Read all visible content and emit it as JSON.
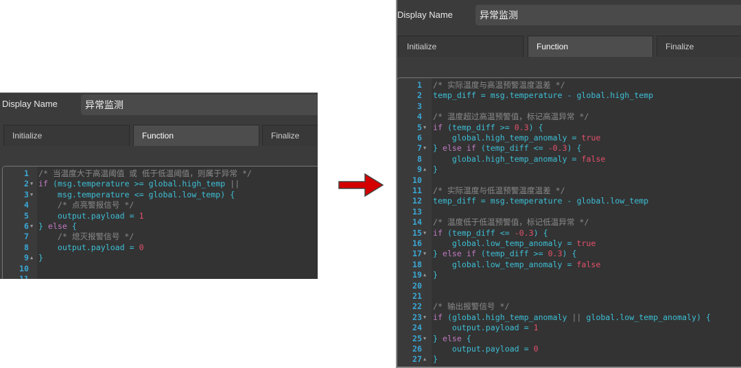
{
  "colors": {
    "arrow": "#d40000",
    "keyword": "#c07ac0",
    "identifier": "#3dbfd6",
    "literal": "#e4506c",
    "comment": "#8a8a8a",
    "line_number": "#3aa8d6"
  },
  "left": {
    "display_name_label": "Display Name",
    "display_name_value": "异常监测",
    "tabs": [
      {
        "label": "Initialize"
      },
      {
        "label": "Function",
        "active": true
      },
      {
        "label": "Finalize"
      }
    ],
    "code": [
      {
        "n": "1",
        "t": [
          [
            "c",
            "/* 当温度大于高温阈值 或 低于低温阈值，则属于异常 */"
          ]
        ]
      },
      {
        "n": "2",
        "f": "down",
        "t": [
          [
            "k",
            "if"
          ],
          [
            "p",
            " ("
          ],
          [
            "i",
            "msg.temperature"
          ],
          [
            "o",
            " >= "
          ],
          [
            "i",
            "global.high_temp"
          ],
          [
            "c",
            " ||"
          ]
        ]
      },
      {
        "n": "3",
        "f": "down",
        "t": [
          [
            "i",
            "    msg.temperature"
          ],
          [
            "o",
            " <= "
          ],
          [
            "i",
            "global.low_temp"
          ],
          [
            "p",
            ") {"
          ]
        ]
      },
      {
        "n": "4",
        "t": [
          [
            "c",
            "    /* 点亮警报信号 */"
          ]
        ]
      },
      {
        "n": "5",
        "t": [
          [
            "i",
            "    output.payload"
          ],
          [
            "o",
            " = "
          ],
          [
            "n",
            "1"
          ]
        ]
      },
      {
        "n": "6",
        "f": "down",
        "t": [
          [
            "p",
            "} "
          ],
          [
            "k",
            "else"
          ],
          [
            "p",
            " {"
          ]
        ]
      },
      {
        "n": "7",
        "t": [
          [
            "c",
            "    /* 熄灭报警信号 */"
          ]
        ]
      },
      {
        "n": "8",
        "t": [
          [
            "i",
            "    output.payload"
          ],
          [
            "o",
            " = "
          ],
          [
            "n",
            "0"
          ]
        ]
      },
      {
        "n": "9",
        "f": "up",
        "t": [
          [
            "p",
            "}"
          ]
        ]
      },
      {
        "n": "10",
        "t": []
      },
      {
        "n": "11",
        "t": []
      }
    ]
  },
  "right": {
    "display_name_label": "Display Name",
    "display_name_value": "异常监测",
    "tabs": [
      {
        "label": "Initialize"
      },
      {
        "label": "Function",
        "active": true
      },
      {
        "label": "Finalize"
      }
    ],
    "code": [
      {
        "n": "1",
        "t": [
          [
            "c",
            "/* 实际温度与高温预警温度温差 */"
          ]
        ]
      },
      {
        "n": "2",
        "t": [
          [
            "i",
            "temp_diff"
          ],
          [
            "o",
            " = "
          ],
          [
            "i",
            "msg.temperature"
          ],
          [
            "o",
            " - "
          ],
          [
            "i",
            "global.high_temp"
          ]
        ]
      },
      {
        "n": "3",
        "t": []
      },
      {
        "n": "4",
        "t": [
          [
            "c",
            "/* 温度超过高温预警值，标记高温异常 */"
          ]
        ]
      },
      {
        "n": "5",
        "f": "down",
        "t": [
          [
            "k",
            "if"
          ],
          [
            "p",
            " ("
          ],
          [
            "i",
            "temp_diff"
          ],
          [
            "o",
            " >= "
          ],
          [
            "n",
            "0.3"
          ],
          [
            "p",
            ") {"
          ]
        ]
      },
      {
        "n": "6",
        "t": [
          [
            "i",
            "    global.high_temp_anomaly"
          ],
          [
            "o",
            " = "
          ],
          [
            "n",
            "true"
          ]
        ]
      },
      {
        "n": "7",
        "f": "down",
        "t": [
          [
            "p",
            "} "
          ],
          [
            "k",
            "else if"
          ],
          [
            "p",
            " ("
          ],
          [
            "i",
            "temp_diff"
          ],
          [
            "o",
            " <= "
          ],
          [
            "n",
            "-0.3"
          ],
          [
            "p",
            ") {"
          ]
        ]
      },
      {
        "n": "8",
        "t": [
          [
            "i",
            "    global.high_temp_anomaly"
          ],
          [
            "o",
            " = "
          ],
          [
            "n",
            "false"
          ]
        ]
      },
      {
        "n": "9",
        "f": "up",
        "t": [
          [
            "p",
            "}"
          ]
        ]
      },
      {
        "n": "10",
        "t": []
      },
      {
        "n": "11",
        "t": [
          [
            "c",
            "/* 实际温度与低温预警温度温差 */"
          ]
        ]
      },
      {
        "n": "12",
        "t": [
          [
            "i",
            "temp_diff"
          ],
          [
            "o",
            " = "
          ],
          [
            "i",
            "msg.temperature"
          ],
          [
            "o",
            " - "
          ],
          [
            "i",
            "global.low_temp"
          ]
        ]
      },
      {
        "n": "13",
        "t": []
      },
      {
        "n": "14",
        "t": [
          [
            "c",
            "/* 温度低于低温预警值，标记低温异常 */"
          ]
        ]
      },
      {
        "n": "15",
        "f": "down",
        "t": [
          [
            "k",
            "if"
          ],
          [
            "p",
            " ("
          ],
          [
            "i",
            "temp_diff"
          ],
          [
            "o",
            " <= "
          ],
          [
            "n",
            "-0.3"
          ],
          [
            "p",
            ") {"
          ]
        ]
      },
      {
        "n": "16",
        "t": [
          [
            "i",
            "    global.low_temp_anomaly"
          ],
          [
            "o",
            " = "
          ],
          [
            "n",
            "true"
          ]
        ]
      },
      {
        "n": "17",
        "f": "down",
        "t": [
          [
            "p",
            "} "
          ],
          [
            "k",
            "else if"
          ],
          [
            "p",
            " ("
          ],
          [
            "i",
            "temp_diff"
          ],
          [
            "o",
            " >= "
          ],
          [
            "n",
            "0.3"
          ],
          [
            "p",
            ") {"
          ]
        ]
      },
      {
        "n": "18",
        "t": [
          [
            "i",
            "    global.low_temp_anomaly"
          ],
          [
            "o",
            " = "
          ],
          [
            "n",
            "false"
          ]
        ]
      },
      {
        "n": "19",
        "f": "up",
        "t": [
          [
            "p",
            "}"
          ]
        ]
      },
      {
        "n": "20",
        "t": []
      },
      {
        "n": "21",
        "t": []
      },
      {
        "n": "22",
        "t": [
          [
            "c",
            "/* 输出报警信号 */"
          ]
        ]
      },
      {
        "n": "23",
        "f": "down",
        "t": [
          [
            "k",
            "if"
          ],
          [
            "p",
            " ("
          ],
          [
            "i",
            "global.high_temp_anomaly"
          ],
          [
            "c",
            " || "
          ],
          [
            "i",
            "global.low_temp_anomaly"
          ],
          [
            "p",
            ") {"
          ]
        ]
      },
      {
        "n": "24",
        "t": [
          [
            "i",
            "    output.payload"
          ],
          [
            "o",
            " = "
          ],
          [
            "n",
            "1"
          ]
        ]
      },
      {
        "n": "25",
        "f": "down",
        "t": [
          [
            "p",
            "} "
          ],
          [
            "k",
            "else"
          ],
          [
            "p",
            " {"
          ]
        ]
      },
      {
        "n": "26",
        "t": [
          [
            "i",
            "    output.payload"
          ],
          [
            "o",
            " = "
          ],
          [
            "n",
            "0"
          ]
        ]
      },
      {
        "n": "27",
        "f": "up",
        "t": [
          [
            "p",
            "}"
          ]
        ]
      }
    ]
  }
}
